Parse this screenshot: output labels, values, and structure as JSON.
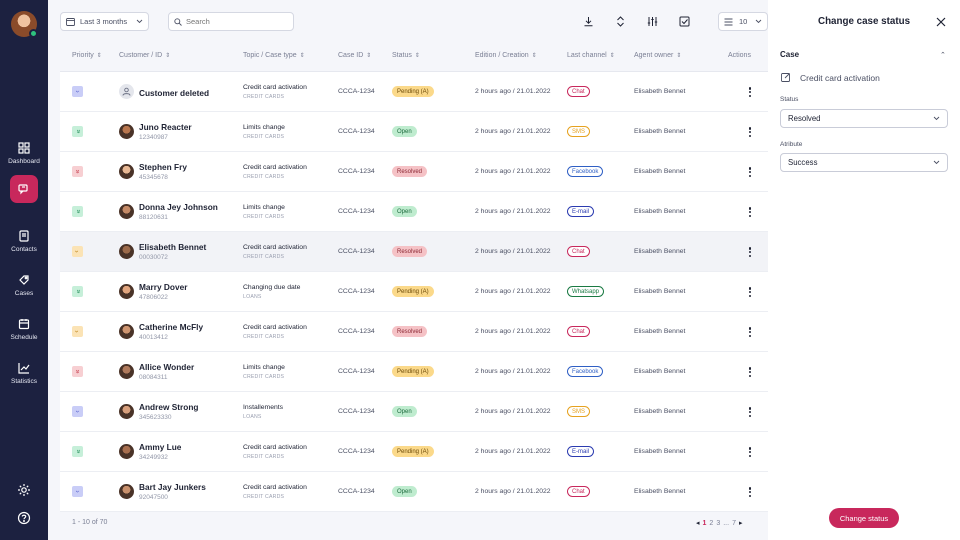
{
  "sidebar": {
    "items": [
      {
        "label": "Dashboard",
        "icon": "dashboard-icon"
      },
      {
        "label": "",
        "icon": "messages-icon",
        "active": true
      },
      {
        "label": "Contacts",
        "icon": "contacts-icon"
      },
      {
        "label": "Cases",
        "icon": "cases-icon"
      },
      {
        "label": "Schedule",
        "icon": "schedule-icon"
      },
      {
        "label": "Statistics",
        "icon": "statistics-icon"
      }
    ],
    "bottom": [
      "settings-icon",
      "help-icon"
    ],
    "accent": "#c8285c"
  },
  "toolbar": {
    "range_label": "Last 3 months",
    "search_placeholder": "Search",
    "rows_per_page": "10"
  },
  "table": {
    "headers": [
      "Priority",
      "Customer / ID",
      "Topic / Case type",
      "Case ID",
      "Status",
      "Edition / Creation",
      "Last channel",
      "Agent owner",
      "Actions"
    ],
    "rows": [
      {
        "priority": "low",
        "name": "Customer deleted",
        "id": "",
        "topic": "Credit card activation",
        "type": "CREDIT CARDS",
        "case_id": "CCCA-1234",
        "status": "Pending (A)",
        "status_kind": "pending",
        "edition": "2 hours ago  / 21.01.2022",
        "channel": "Chat",
        "channel_kind": "chat",
        "agent": "Elisabeth Bennet"
      },
      {
        "priority": "lowest",
        "name": "Juno Reacter",
        "id": "12340987",
        "topic": "Limits change",
        "type": "CREDIT CARDS",
        "case_id": "CCCA-1234",
        "status": "Open",
        "status_kind": "open",
        "edition": "2 hours ago  / 21.01.2022",
        "channel": "SMS",
        "channel_kind": "sms",
        "agent": "Elisabeth Bennet"
      },
      {
        "priority": "highest",
        "name": "Stephen Fry",
        "id": "45345678",
        "topic": "Credit card activation",
        "type": "CREDIT CARDS",
        "case_id": "CCCA-1234",
        "status": "Resolved",
        "status_kind": "resolved",
        "edition": "2 hours ago  / 21.01.2022",
        "channel": "Facebook",
        "channel_kind": "facebook",
        "agent": "Elisabeth Bennet"
      },
      {
        "priority": "lowest",
        "name": "Donna Jey Johnson",
        "id": "88120631",
        "topic": "Limits change",
        "type": "CREDIT CARDS",
        "case_id": "CCCA-1234",
        "status": "Open",
        "status_kind": "open",
        "edition": "2 hours ago  / 21.01.2022",
        "channel": "E-mail",
        "channel_kind": "email",
        "agent": "Elisabeth Bennet"
      },
      {
        "priority": "high",
        "name": "Elisabeth Bennet",
        "id": "00030072",
        "topic": "Credit card activation",
        "type": "CREDIT CARDS",
        "case_id": "CCCA-1234",
        "status": "Resolved",
        "status_kind": "resolved",
        "edition": "2 hours ago  / 21.01.2022",
        "channel": "Chat",
        "channel_kind": "chat",
        "agent": "Elisabeth Bennet"
      },
      {
        "priority": "lowest",
        "name": "Marry Dover",
        "id": "47806022",
        "topic": "Changing due date",
        "type": "LOANS",
        "case_id": "CCCA-1234",
        "status": "Pending (A)",
        "status_kind": "pending",
        "edition": "2 hours ago  / 21.01.2022",
        "channel": "Whatsapp",
        "channel_kind": "whatsapp",
        "agent": "Elisabeth Bennet"
      },
      {
        "priority": "high",
        "name": "Catherine McFly",
        "id": "40013412",
        "topic": "Credit card activation",
        "type": "CREDIT CARDS",
        "case_id": "CCCA-1234",
        "status": "Resolved",
        "status_kind": "resolved",
        "edition": "2 hours ago  / 21.01.2022",
        "channel": "Chat",
        "channel_kind": "chat",
        "agent": "Elisabeth Bennet"
      },
      {
        "priority": "highest",
        "name": "Allice Wonder",
        "id": "08084311",
        "topic": "Limits change",
        "type": "CREDIT CARDS",
        "case_id": "CCCA-1234",
        "status": "Pending (A)",
        "status_kind": "pending",
        "edition": "2 hours ago  / 21.01.2022",
        "channel": "Facebook",
        "channel_kind": "facebook",
        "agent": "Elisabeth Bennet"
      },
      {
        "priority": "low",
        "name": "Andrew Strong",
        "id": "345623330",
        "topic": "Installements",
        "type": "LOANS",
        "case_id": "CCCA-1234",
        "status": "Open",
        "status_kind": "open",
        "edition": "2 hours ago  / 21.01.2022",
        "channel": "SMS",
        "channel_kind": "sms",
        "agent": "Elisabeth Bennet"
      },
      {
        "priority": "lowest",
        "name": "Ammy Lue",
        "id": "34249932",
        "topic": "Credit card activation",
        "type": "CREDIT CARDS",
        "case_id": "CCCA-1234",
        "status": "Pending (A)",
        "status_kind": "pending",
        "edition": "2 hours ago  / 21.01.2022",
        "channel": "E-mail",
        "channel_kind": "email",
        "agent": "Elisabeth Bennet"
      },
      {
        "priority": "low",
        "name": "Bart Jay Junkers",
        "id": "92047500",
        "topic": "Credit card activation",
        "type": "CREDIT CARDS",
        "case_id": "CCCA-1234",
        "status": "Open",
        "status_kind": "open",
        "edition": "2 hours ago  / 21.01.2022",
        "channel": "Chat",
        "channel_kind": "chat",
        "agent": "Elisabeth Bennet"
      }
    ]
  },
  "footer": {
    "count": "1 - 10 of 70",
    "pages": [
      "1",
      "2",
      "3",
      "...",
      "7"
    ],
    "current_page": "1"
  },
  "panel": {
    "title": "Change case status",
    "section": "Case",
    "case_topic": "Credit card activation",
    "status_label": "Status",
    "status_value": "Resolved",
    "attribute_label": "Atribute",
    "attribute_value": "Success",
    "submit_label": "Change status"
  }
}
